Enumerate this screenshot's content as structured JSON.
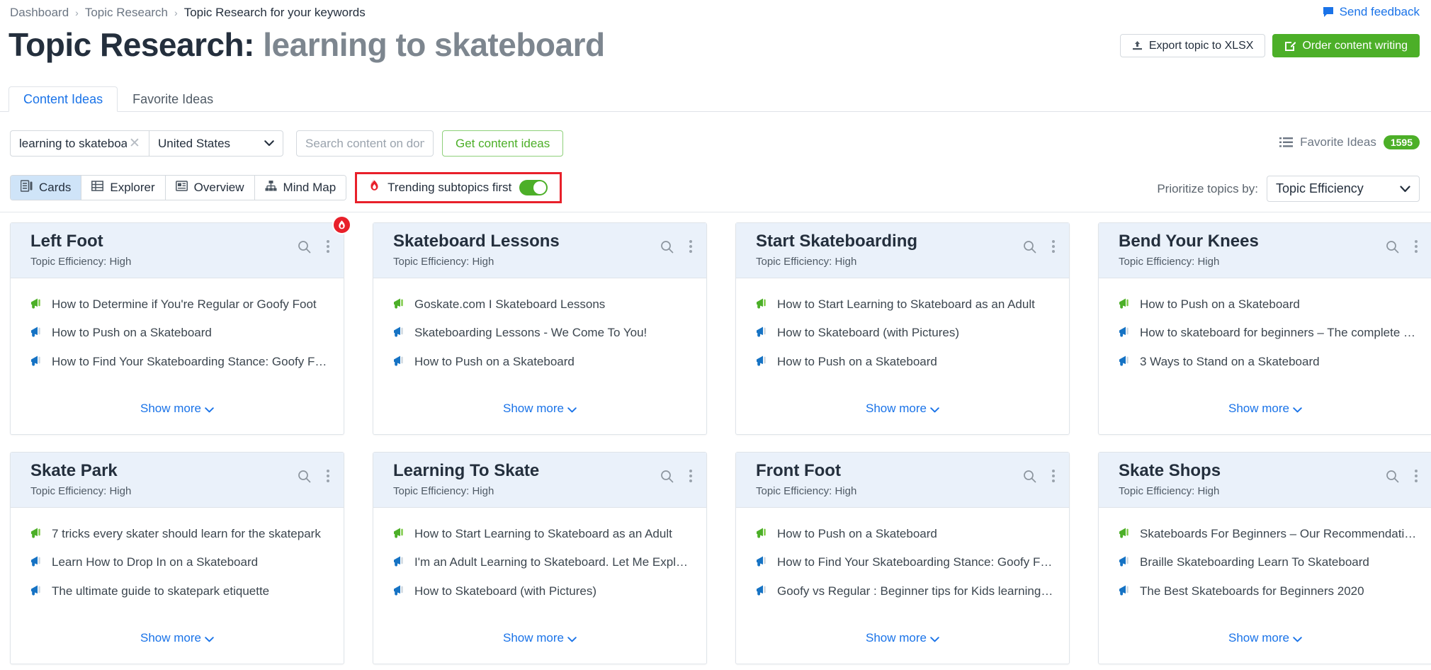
{
  "breadcrumb": {
    "items": [
      "Dashboard",
      "Topic Research",
      "Topic Research for your keywords"
    ]
  },
  "feedback": {
    "label": "Send feedback"
  },
  "title": {
    "prefix": "Topic Research:",
    "keyword": "learning to skateboard"
  },
  "header_actions": {
    "export_label": "Export topic to XLSX",
    "order_label": "Order content writing"
  },
  "tabs": [
    {
      "label": "Content Ideas",
      "active": true
    },
    {
      "label": "Favorite Ideas",
      "active": false
    }
  ],
  "filters": {
    "keyword_value": "learning to skateboard",
    "country_value": "United States",
    "domain_placeholder": "Search content on domain",
    "domain_value": "",
    "get_ideas_label": "Get content ideas"
  },
  "favorite_ideas": {
    "label": "Favorite Ideas",
    "count": "1595"
  },
  "views": [
    {
      "label": "Cards",
      "icon": "cards-icon",
      "active": true
    },
    {
      "label": "Explorer",
      "icon": "table-icon",
      "active": false
    },
    {
      "label": "Overview",
      "icon": "document-icon",
      "active": false
    },
    {
      "label": "Mind Map",
      "icon": "mindmap-icon",
      "active": false
    }
  ],
  "trending": {
    "label": "Trending subtopics first",
    "enabled": true,
    "icon": "flame-icon"
  },
  "prioritize": {
    "label": "Prioritize topics by:",
    "value": "Topic Efficiency"
  },
  "card_meta": {
    "efficiency_label": "Topic Efficiency:",
    "show_more_label": "Show more"
  },
  "colors": {
    "accent_blue": "#1a73e8",
    "green": "#4caf28",
    "red": "#e8202a",
    "card_header_bg": "#eaf1fa"
  },
  "cards": [
    {
      "title": "Left Foot",
      "efficiency": "High",
      "trending": true,
      "ideas": [
        {
          "text": "How to Determine if You're Regular or Goofy Foot",
          "color": "green"
        },
        {
          "text": "How to Push on a Skateboard",
          "color": "blue"
        },
        {
          "text": "How to Find Your Skateboarding Stance: Goofy Fo…",
          "color": "blue"
        }
      ]
    },
    {
      "title": "Skateboard Lessons",
      "efficiency": "High",
      "trending": false,
      "ideas": [
        {
          "text": "Goskate.com I Skateboard Lessons",
          "color": "green"
        },
        {
          "text": "Skateboarding Lessons - We Come To You!",
          "color": "blue"
        },
        {
          "text": "How to Push on a Skateboard",
          "color": "blue"
        }
      ]
    },
    {
      "title": "Start Skateboarding",
      "efficiency": "High",
      "trending": false,
      "ideas": [
        {
          "text": "How to Start Learning to Skateboard as an Adult",
          "color": "green"
        },
        {
          "text": "How to Skateboard (with Pictures)",
          "color": "blue"
        },
        {
          "text": "How to Push on a Skateboard",
          "color": "blue"
        }
      ]
    },
    {
      "title": "Bend Your Knees",
      "efficiency": "High",
      "trending": false,
      "ideas": [
        {
          "text": "How to Push on a Skateboard",
          "color": "green"
        },
        {
          "text": "How to skateboard for beginners – The complete …",
          "color": "blue"
        },
        {
          "text": "3 Ways to Stand on a Skateboard",
          "color": "blue"
        }
      ]
    },
    {
      "title": "Skate Park",
      "efficiency": "High",
      "trending": false,
      "ideas": [
        {
          "text": "7 tricks every skater should learn for the skatepark",
          "color": "green"
        },
        {
          "text": "Learn How to Drop In on a Skateboard",
          "color": "blue"
        },
        {
          "text": "The ultimate guide to skatepark etiquette",
          "color": "blue"
        }
      ]
    },
    {
      "title": "Learning To Skate",
      "efficiency": "High",
      "trending": false,
      "ideas": [
        {
          "text": "How to Start Learning to Skateboard as an Adult",
          "color": "green"
        },
        {
          "text": "I'm an Adult Learning to Skateboard. Let Me Explain.",
          "color": "blue"
        },
        {
          "text": "How to Skateboard (with Pictures)",
          "color": "blue"
        }
      ]
    },
    {
      "title": "Front Foot",
      "efficiency": "High",
      "trending": false,
      "ideas": [
        {
          "text": "How to Push on a Skateboard",
          "color": "green"
        },
        {
          "text": "How to Find Your Skateboarding Stance: Goofy Fo…",
          "color": "blue"
        },
        {
          "text": "Goofy vs Regular : Beginner tips for Kids learning t…",
          "color": "blue"
        }
      ]
    },
    {
      "title": "Skate Shops",
      "efficiency": "High",
      "trending": false,
      "ideas": [
        {
          "text": "Skateboards For Beginners – Our Recommendations",
          "color": "green"
        },
        {
          "text": "Braille Skateboarding Learn To Skateboard",
          "color": "blue"
        },
        {
          "text": "The Best Skateboards for Beginners 2020",
          "color": "blue"
        }
      ]
    }
  ]
}
